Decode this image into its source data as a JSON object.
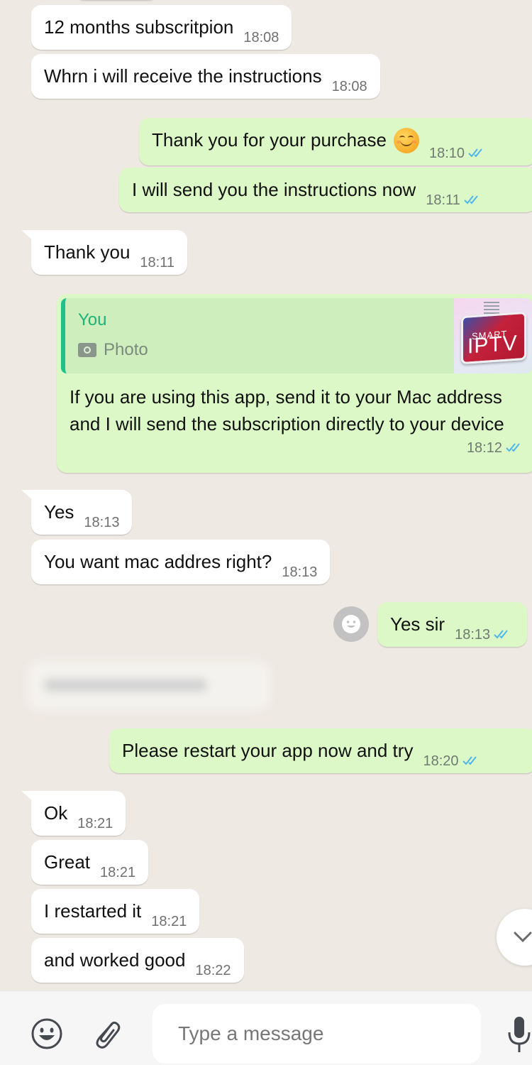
{
  "colors": {
    "background": "#efe9e3",
    "incoming_bubble": "#ffffff",
    "outgoing_bubble": "#dcf8c6",
    "read_ticks": "#4fb6ec",
    "quote_accent": "#1fc08a"
  },
  "messages": [
    {
      "direction": "in",
      "text": "12 months subscritpion",
      "time": "18:08"
    },
    {
      "direction": "in",
      "text": "Whrn i will receive the instructions",
      "time": "18:08"
    },
    {
      "direction": "out",
      "text": "Thank you for your purchase",
      "emoji": "smiling-face-icon",
      "time": "18:10",
      "status": "read"
    },
    {
      "direction": "out",
      "text": "I will send you the instructions now",
      "time": "18:11",
      "status": "read"
    },
    {
      "direction": "in",
      "text": "Thank you",
      "time": "18:11"
    },
    {
      "direction": "out",
      "reply_to": {
        "author": "You",
        "type_label": "Photo",
        "thumbnail": {
          "top_text": "SMART",
          "main_text": "IPTV"
        }
      },
      "text": "If you are using this app, send it to your Mac address and I will send the subscription directly to your device",
      "time": "18:12",
      "status": "read"
    },
    {
      "direction": "in",
      "text": "Yes",
      "time": "18:13"
    },
    {
      "direction": "in",
      "text": "You want mac addres right?",
      "time": "18:13"
    },
    {
      "direction": "out",
      "text": "Yes sir",
      "time": "18:13",
      "status": "read"
    },
    {
      "direction": "in",
      "text": "",
      "redacted": true
    },
    {
      "direction": "out",
      "text": "Please restart your app now and try",
      "time": "18:20",
      "status": "read"
    },
    {
      "direction": "in",
      "text": "Ok",
      "time": "18:21"
    },
    {
      "direction": "in",
      "text": "Great",
      "time": "18:21"
    },
    {
      "direction": "in",
      "text": "I restarted it",
      "time": "18:21"
    },
    {
      "direction": "in",
      "text": "and worked good",
      "time": "18:22"
    }
  ],
  "composer": {
    "placeholder": "Type a message",
    "emoji_icon": "emoji-icon",
    "attach_icon": "paperclip-icon",
    "mic_icon": "microphone-icon"
  },
  "scroll_button_icon": "chevron-down-icon",
  "reaction_button_icon": "emoji-reaction-icon"
}
